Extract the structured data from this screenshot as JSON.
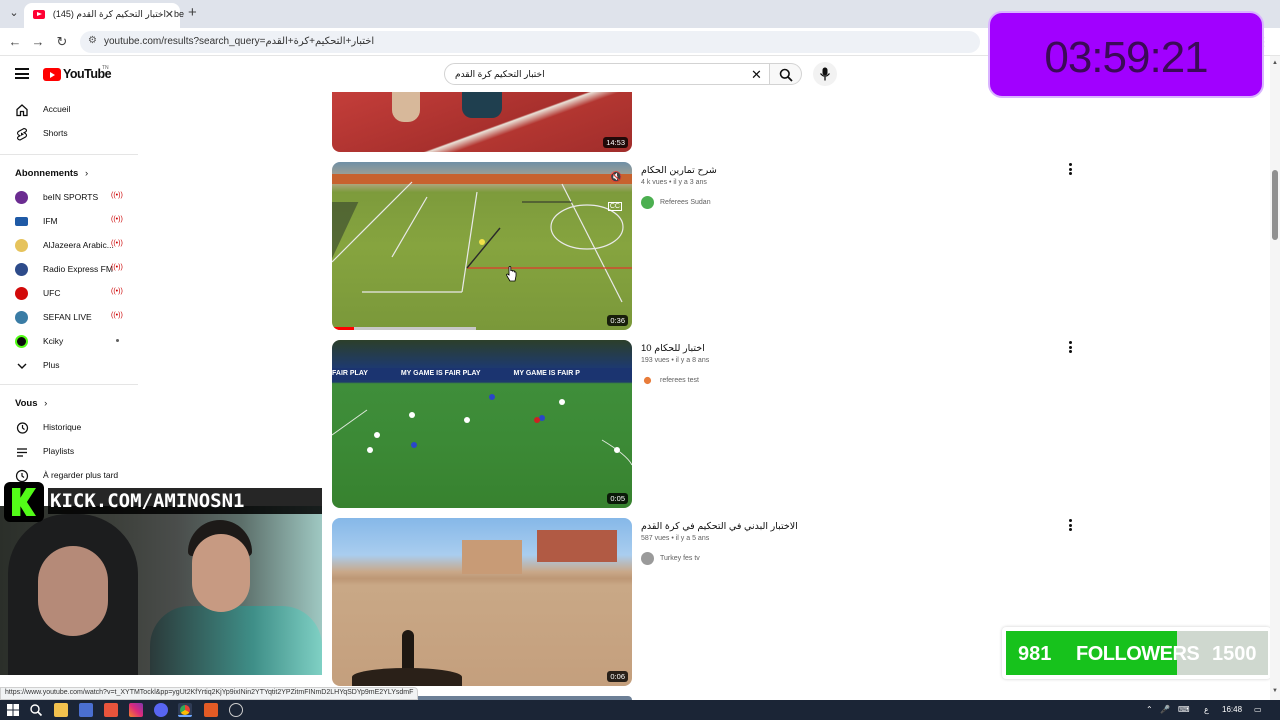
{
  "browser": {
    "tab_title": "be - اختبار التحكيم كرة القدم (145)",
    "new_tab": "+",
    "url": "youtube.com/results?search_query=اختبار+التحكيم+كرة+القدم"
  },
  "youtube": {
    "logo_text": "YouTube",
    "country": "TN",
    "search_value": "اختبار التحكيم كرة القدم"
  },
  "sidebar": {
    "main": [
      {
        "label": "Accueil",
        "icon": "home-icon"
      },
      {
        "label": "Shorts",
        "icon": "shorts-icon"
      }
    ],
    "subs_title": "Abonnements",
    "subs": [
      {
        "label": "beIN SPORTS",
        "live": "((•))",
        "color": "#6b2c91"
      },
      {
        "label": "IFM",
        "live": "((•))",
        "color": "#1f5aa6"
      },
      {
        "label": "AlJazeera Arabic...",
        "live": "((•))",
        "color": "#d9a520"
      },
      {
        "label": "Radio Express FM",
        "live": "((•))",
        "color": "#2d4b8a"
      },
      {
        "label": "UFC",
        "live": "((•))",
        "color": "#d20a0a"
      },
      {
        "label": "SEFAN LIVE",
        "live": "((•))",
        "color": "#3a7ca5"
      },
      {
        "label": "Kciky",
        "live": "",
        "color": "#0b0b0b"
      }
    ],
    "more_label": "Plus",
    "you_title": "Vous",
    "you": [
      {
        "label": "Historique",
        "icon": "history-icon"
      },
      {
        "label": "Playlists",
        "icon": "playlists-icon"
      },
      {
        "label": "À regarder plus tard",
        "icon": "watch-later-icon"
      }
    ]
  },
  "videos": [
    {
      "title": "",
      "meta": "",
      "channel": "",
      "duration": "14:53"
    },
    {
      "title": "شرح تمارين الحكام",
      "meta": "4 k vues • il y a 3 ans",
      "channel": "Referees Sudan",
      "duration": "0:36"
    },
    {
      "title": "اختبار للحكام 10",
      "meta": "193 vues • il y a 8 ans",
      "channel": "referees test",
      "duration": "0:05"
    },
    {
      "title": "الاختبار البدني في التحكيم في كرة القدم",
      "meta": "587 vues • il y a 5 ans",
      "channel": "Turkey fes tv",
      "duration": "0:06"
    }
  ],
  "overlays": {
    "timer": "03:59:21",
    "kick_url": "KICK.COM/AMINOSN1",
    "followers_count": "981",
    "followers_label": "FOLLOWERS",
    "followers_goal": "1500",
    "followers_progress": 0.654
  },
  "status_url": "https://www.youtube.com/watch?v=t_XYTMTockl&pp=ygUt2KfYrtiq2KjYp9ixINin2YTYqtit2YPZitmFINmD2LHYqSDYp9mE2YLYsdmF",
  "taskbar": {
    "lang": "ع",
    "time": "16:48"
  }
}
